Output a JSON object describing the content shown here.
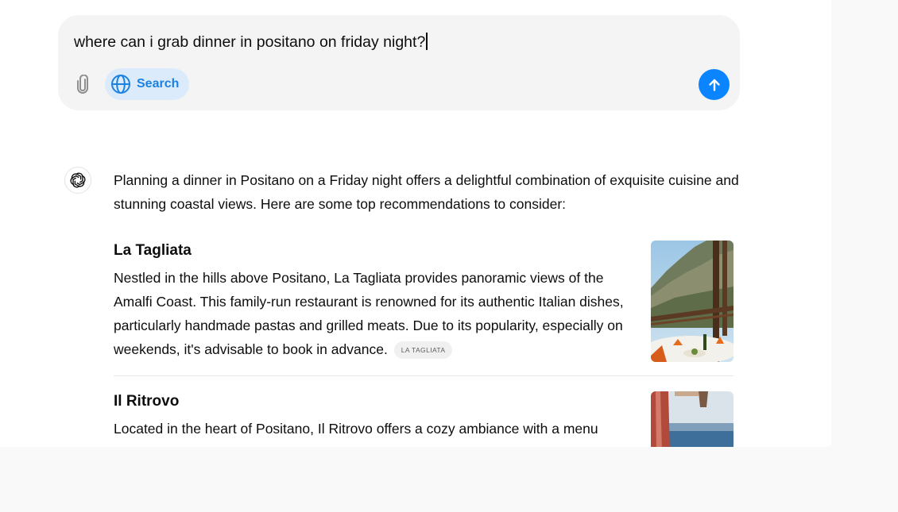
{
  "composer": {
    "input_value": "where can i grab dinner in positano on friday night?",
    "search_label": "Search",
    "icons": {
      "attach": "paperclip-icon",
      "search": "globe-icon",
      "send": "arrow-up-icon"
    },
    "colors": {
      "accent": "#0b85ff",
      "search_bg": "#dcebfb",
      "search_text": "#1b82e0"
    }
  },
  "response": {
    "avatar_icon": "openai-logo-icon",
    "intro": "Planning a dinner in Positano on a Friday night offers a delightful combination of exquisite cuisine and stunning coastal views. Here are some top recommendations to consider:",
    "recommendations": [
      {
        "name": "La Tagliata",
        "description": "Nestled in the hills above Positano, La Tagliata provides panoramic views of the Amalfi Coast. This family-run restaurant is renowned for its authentic Italian dishes, particularly handmade pastas and grilled meats. Due to its popularity, especially on weekends, it's advisable to book in advance.",
        "source": "LA TAGLIATA"
      },
      {
        "name": "Il Ritrovo",
        "description": "Located in the heart of Positano, Il Ritrovo offers a cozy ambiance with a menu"
      }
    ]
  }
}
